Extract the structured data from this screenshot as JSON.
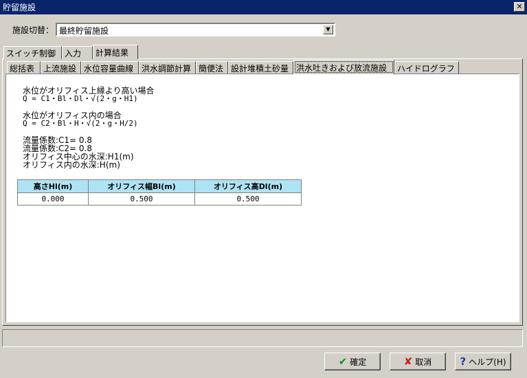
{
  "window": {
    "title": "貯留施設",
    "close_glyph": "✕"
  },
  "switch": {
    "label": "施設切替：",
    "value": "最終貯留施設",
    "drop_glyph": "▼"
  },
  "tabs_main": [
    {
      "label": "スイッチ制御"
    },
    {
      "label": "入力"
    },
    {
      "label": "計算結果"
    }
  ],
  "tabs_sub": [
    {
      "label": "総括表"
    },
    {
      "label": "上流施設"
    },
    {
      "label": "水位容量曲線"
    },
    {
      "label": "洪水調節計算"
    },
    {
      "label": "簡便法"
    },
    {
      "label": "設計堆積土砂量"
    },
    {
      "label": "洪水吐きおよび放流施設"
    },
    {
      "label": "ハイドログラフ"
    }
  ],
  "formula": {
    "case1_title": "水位がオリフィス上縁より高い場合",
    "case1_eq": "Q = C1・Bl・Dl・√(2・g・H1)",
    "case2_title": "水位がオリフィス内の場合",
    "case2_eq": "Q = C2・Bl・H・√(2・g・H/2)",
    "c1": "流量係数:C1= 0.8",
    "c2": "流量係数:C2= 0.8",
    "h1": "オリフィス中心の水深:H1(m)",
    "h": "オリフィス内の水深:H(m)"
  },
  "table": {
    "headers": [
      "高さHl(m)",
      "オリフィス幅Bl(m)",
      "オリフィス高Dl(m)"
    ],
    "row": [
      "0.000",
      "0.500",
      "0.500"
    ]
  },
  "buttons": {
    "ok": "確定",
    "ok_icon": "✔",
    "cancel": "取消",
    "cancel_icon": "✘",
    "help": "ヘルプ(H)",
    "help_icon": "?"
  }
}
